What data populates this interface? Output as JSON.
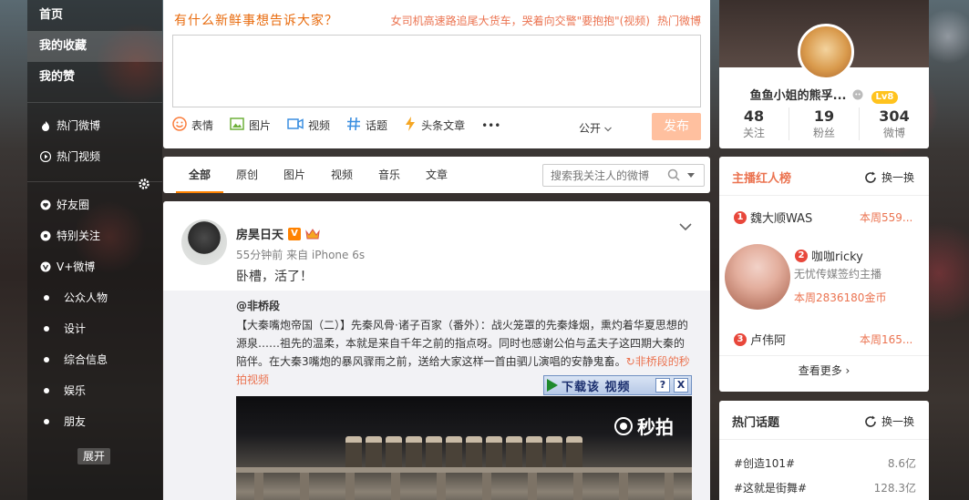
{
  "nav": {
    "top_items": [
      {
        "label": "首页"
      },
      {
        "label": "我的收藏"
      },
      {
        "label": "我的赞"
      }
    ],
    "hot_items": [
      {
        "label": "热门微博",
        "icon": "fire-icon"
      },
      {
        "label": "热门视频",
        "icon": "play-icon"
      }
    ],
    "group_items": [
      {
        "label": "好友圈",
        "icon": "heart-icon"
      },
      {
        "label": "特别关注",
        "icon": "eye-icon"
      },
      {
        "label": "V+微博",
        "icon": "vplus-icon"
      },
      {
        "label": "公众人物"
      },
      {
        "label": "设计"
      },
      {
        "label": "综合信息"
      },
      {
        "label": "娱乐"
      },
      {
        "label": "朋友"
      }
    ],
    "expand_label": "展开"
  },
  "composer": {
    "prompt": "有什么新鲜事想告诉大家？",
    "hot_news": "女司机高速路追尾大货车，哭着向交警\"要抱抱\"(视频)",
    "hot_weibo": "热门微博",
    "textarea_value": "",
    "tools": [
      {
        "label": "表情",
        "icon": "emoji-icon",
        "color": "#fa7d3c"
      },
      {
        "label": "图片",
        "icon": "image-icon",
        "color": "#6eb03a"
      },
      {
        "label": "视频",
        "icon": "video-icon",
        "color": "#3a8ee0"
      },
      {
        "label": "话题",
        "icon": "hashtag-icon",
        "color": "#3a8ee0"
      },
      {
        "label": "头条文章",
        "icon": "lightning-icon",
        "color": "#f5a623"
      },
      {
        "label": "•••",
        "icon": "more-icon",
        "color": "#666666"
      }
    ],
    "visibility": "公开",
    "send_label": "发布"
  },
  "tabs": {
    "items": [
      {
        "label": "全部",
        "active": true
      },
      {
        "label": "原创"
      },
      {
        "label": "图片"
      },
      {
        "label": "视频"
      },
      {
        "label": "音乐"
      },
      {
        "label": "文章"
      }
    ],
    "search_placeholder": "搜索我关注人的微博"
  },
  "post": {
    "username": "房昊日天",
    "v_badge": "V",
    "meta": "55分钟前 来自 iPhone 6s",
    "content": "卧槽，活了！",
    "repost": {
      "user": "@非桥段",
      "text_main": "【大秦嘴炮帝国（二）】先秦风骨·诸子百家（番外）：战火笼罩的先秦烽烟，熏灼着华夏思想的源泉……祖先的温柔，本就是来自千年之前的指点呀。同时也感谢公伯与孟夫子这四期大秦的陪伴。在大秦3嘴炮的暴风骤雨之前，送给大家这样一首由驷儿演唱的安静鬼畜。",
      "text_link": "↻非桥段的秒拍视频",
      "video_logo": "秒拍"
    }
  },
  "download_bar": {
    "label": "下载该 视频",
    "help": "?",
    "close": "X"
  },
  "profile": {
    "name": "鱼鱼小姐的熊孚...",
    "level": "Lv8",
    "stats": [
      {
        "num": "48",
        "label": "关注"
      },
      {
        "num": "19",
        "label": "粉丝"
      },
      {
        "num": "304",
        "label": "微博"
      }
    ]
  },
  "ranking": {
    "title": "主播红人榜",
    "refresh": "换一换",
    "items": [
      {
        "rank": "1",
        "name": "魏大顺WAS",
        "score": "本周559..."
      },
      {
        "rank": "2",
        "name": "咖咖ricky",
        "desc": "无忧传媒签约主播",
        "score": "本周2836180金币"
      },
      {
        "rank": "3",
        "name": "卢伟阿",
        "score": "本周165..."
      }
    ],
    "more": "查看更多 ›"
  },
  "topics": {
    "title": "热门话题",
    "refresh": "换一换",
    "items": [
      {
        "name": "#创造101#",
        "value": "8.6亿"
      },
      {
        "name": "#这就是街舞#",
        "value": "128.3亿"
      }
    ]
  }
}
